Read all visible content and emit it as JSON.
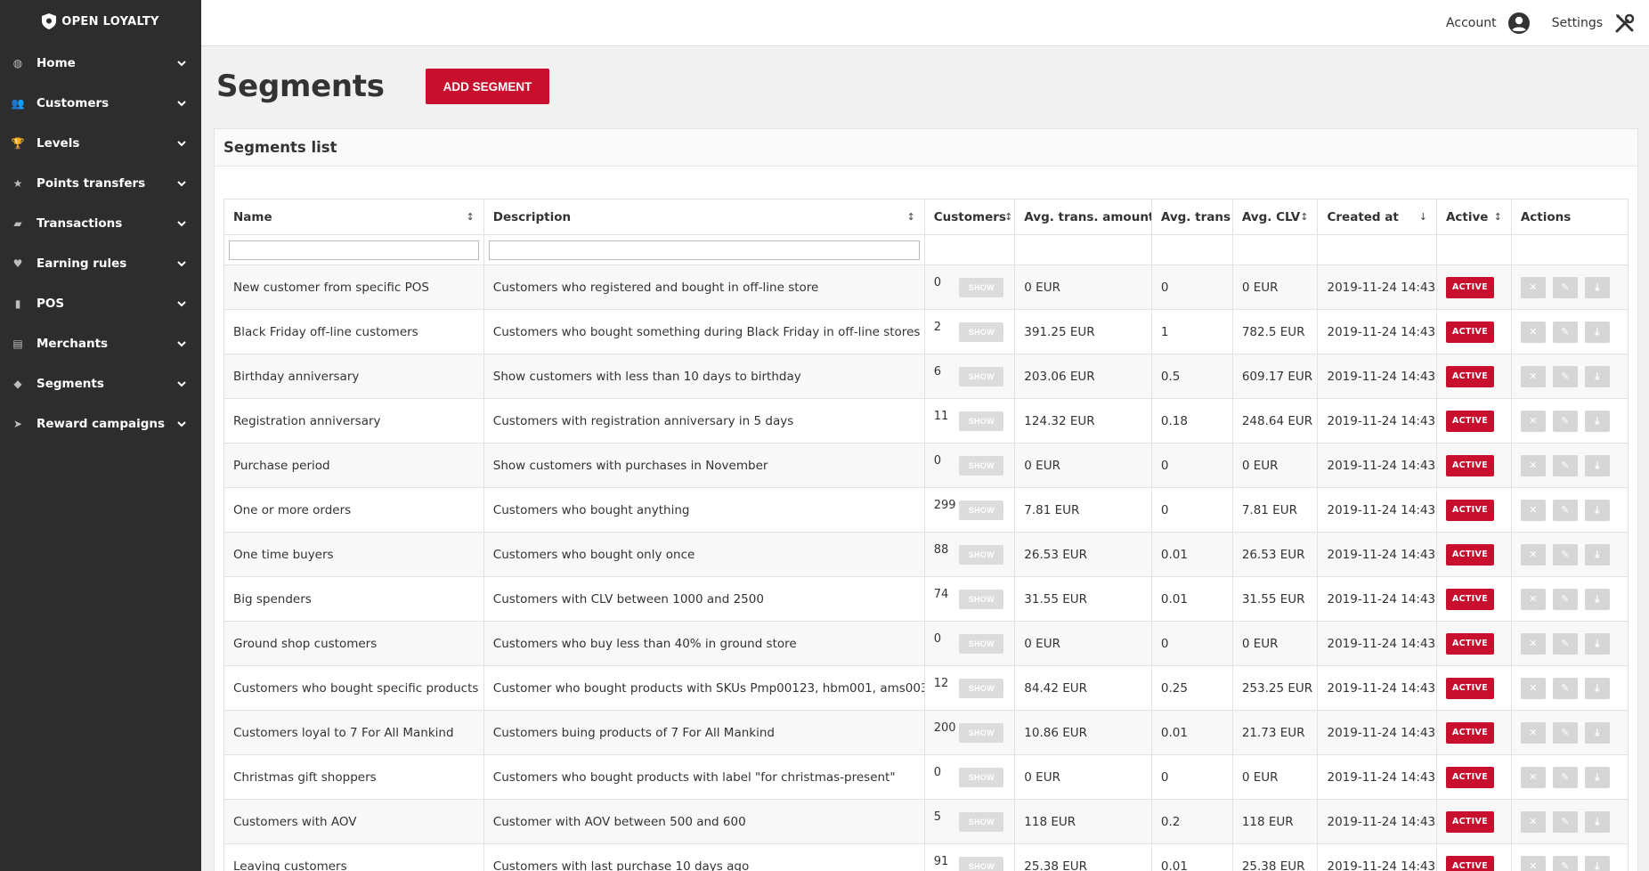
{
  "app": {
    "logo_text": "OPEN LOYALTY"
  },
  "sidebar": {
    "items": [
      {
        "label": "Home",
        "icon": "dashboard-icon"
      },
      {
        "label": "Customers",
        "icon": "users-icon"
      },
      {
        "label": "Levels",
        "icon": "trophy-icon"
      },
      {
        "label": "Points transfers",
        "icon": "star-icon"
      },
      {
        "label": "Transactions",
        "icon": "briefcase-icon"
      },
      {
        "label": "Earning rules",
        "icon": "heart-icon"
      },
      {
        "label": "POS",
        "icon": "device-icon"
      },
      {
        "label": "Merchants",
        "icon": "id-card-icon"
      },
      {
        "label": "Segments",
        "icon": "tags-icon"
      },
      {
        "label": "Reward campaigns",
        "icon": "send-icon"
      }
    ]
  },
  "topbar": {
    "account_label": "Account",
    "settings_label": "Settings"
  },
  "page": {
    "title": "Segments",
    "add_button": "ADD SEGMENT"
  },
  "panel": {
    "title": "Segments list"
  },
  "table": {
    "headers": {
      "name": "Name",
      "description": "Description",
      "customers": "Customers",
      "avg_amount": "Avg. trans. amount",
      "avg_trans": "Avg. trans",
      "avg_clv": "Avg. CLV",
      "created_at": "Created at",
      "active": "Active",
      "actions": "Actions"
    },
    "show_label": "SHOW",
    "active_label": "ACTIVE",
    "rows": [
      {
        "name": "New customer from specific POS",
        "description": "Customers who registered and bought in off-line store",
        "customers": "0",
        "avg_amount": "0 EUR",
        "avg_trans": "0",
        "avg_clv": "0 EUR",
        "created_at": "2019-11-24 14:43"
      },
      {
        "name": "Black Friday off-line customers",
        "description": "Customers who bought something during Black Friday in off-line stores",
        "customers": "2",
        "avg_amount": "391.25 EUR",
        "avg_trans": "1",
        "avg_clv": "782.5 EUR",
        "created_at": "2019-11-24 14:43"
      },
      {
        "name": "Birthday anniversary",
        "description": "Show customers with less than 10 days to birthday",
        "customers": "6",
        "avg_amount": "203.06 EUR",
        "avg_trans": "0.5",
        "avg_clv": "609.17 EUR",
        "created_at": "2019-11-24 14:43"
      },
      {
        "name": "Registration anniversary",
        "description": "Customers with registration anniversary in 5 days",
        "customers": "11",
        "avg_amount": "124.32 EUR",
        "avg_trans": "0.18",
        "avg_clv": "248.64 EUR",
        "created_at": "2019-11-24 14:43"
      },
      {
        "name": "Purchase period",
        "description": "Show customers with purchases in November",
        "customers": "0",
        "avg_amount": "0 EUR",
        "avg_trans": "0",
        "avg_clv": "0 EUR",
        "created_at": "2019-11-24 14:43"
      },
      {
        "name": "One or more orders",
        "description": "Customers who bought anything",
        "customers": "299",
        "avg_amount": "7.81 EUR",
        "avg_trans": "0",
        "avg_clv": "7.81 EUR",
        "created_at": "2019-11-24 14:43"
      },
      {
        "name": "One time buyers",
        "description": "Customers who bought only once",
        "customers": "88",
        "avg_amount": "26.53 EUR",
        "avg_trans": "0.01",
        "avg_clv": "26.53 EUR",
        "created_at": "2019-11-24 14:43"
      },
      {
        "name": "Big spenders",
        "description": "Customers with CLV between 1000 and 2500",
        "customers": "74",
        "avg_amount": "31.55 EUR",
        "avg_trans": "0.01",
        "avg_clv": "31.55 EUR",
        "created_at": "2019-11-24 14:43"
      },
      {
        "name": "Ground shop customers",
        "description": "Customers who buy less than 40% in ground store",
        "customers": "0",
        "avg_amount": "0 EUR",
        "avg_trans": "0",
        "avg_clv": "0 EUR",
        "created_at": "2019-11-24 14:43"
      },
      {
        "name": "Customers who bought specific products",
        "description": "Customer who bought products with SKUs Pmp00123, hbm001, ams003",
        "customers": "12",
        "avg_amount": "84.42 EUR",
        "avg_trans": "0.25",
        "avg_clv": "253.25 EUR",
        "created_at": "2019-11-24 14:43"
      },
      {
        "name": "Customers loyal to 7 For All Mankind",
        "description": "Customers buing products of 7 For All Mankind",
        "customers": "200",
        "avg_amount": "10.86 EUR",
        "avg_trans": "0.01",
        "avg_clv": "21.73 EUR",
        "created_at": "2019-11-24 14:43"
      },
      {
        "name": "Christmas gift shoppers",
        "description": "Customers who bought products with label \"for christmas-present\"",
        "customers": "0",
        "avg_amount": "0 EUR",
        "avg_trans": "0",
        "avg_clv": "0 EUR",
        "created_at": "2019-11-24 14:43"
      },
      {
        "name": "Customers with AOV",
        "description": "Customer with AOV between 500 and 600",
        "customers": "5",
        "avg_amount": "118 EUR",
        "avg_trans": "0.2",
        "avg_clv": "118 EUR",
        "created_at": "2019-11-24 14:43"
      },
      {
        "name": "Leaving customers",
        "description": "Customers with last purchase 10 days ago",
        "customers": "91",
        "avg_amount": "25.38 EUR",
        "avg_trans": "0.01",
        "avg_clv": "25.38 EUR",
        "created_at": "2019-11-24 14:43"
      }
    ]
  },
  "colors": {
    "accent": "#c8102e",
    "sidebar_bg": "#2d2d2d"
  }
}
